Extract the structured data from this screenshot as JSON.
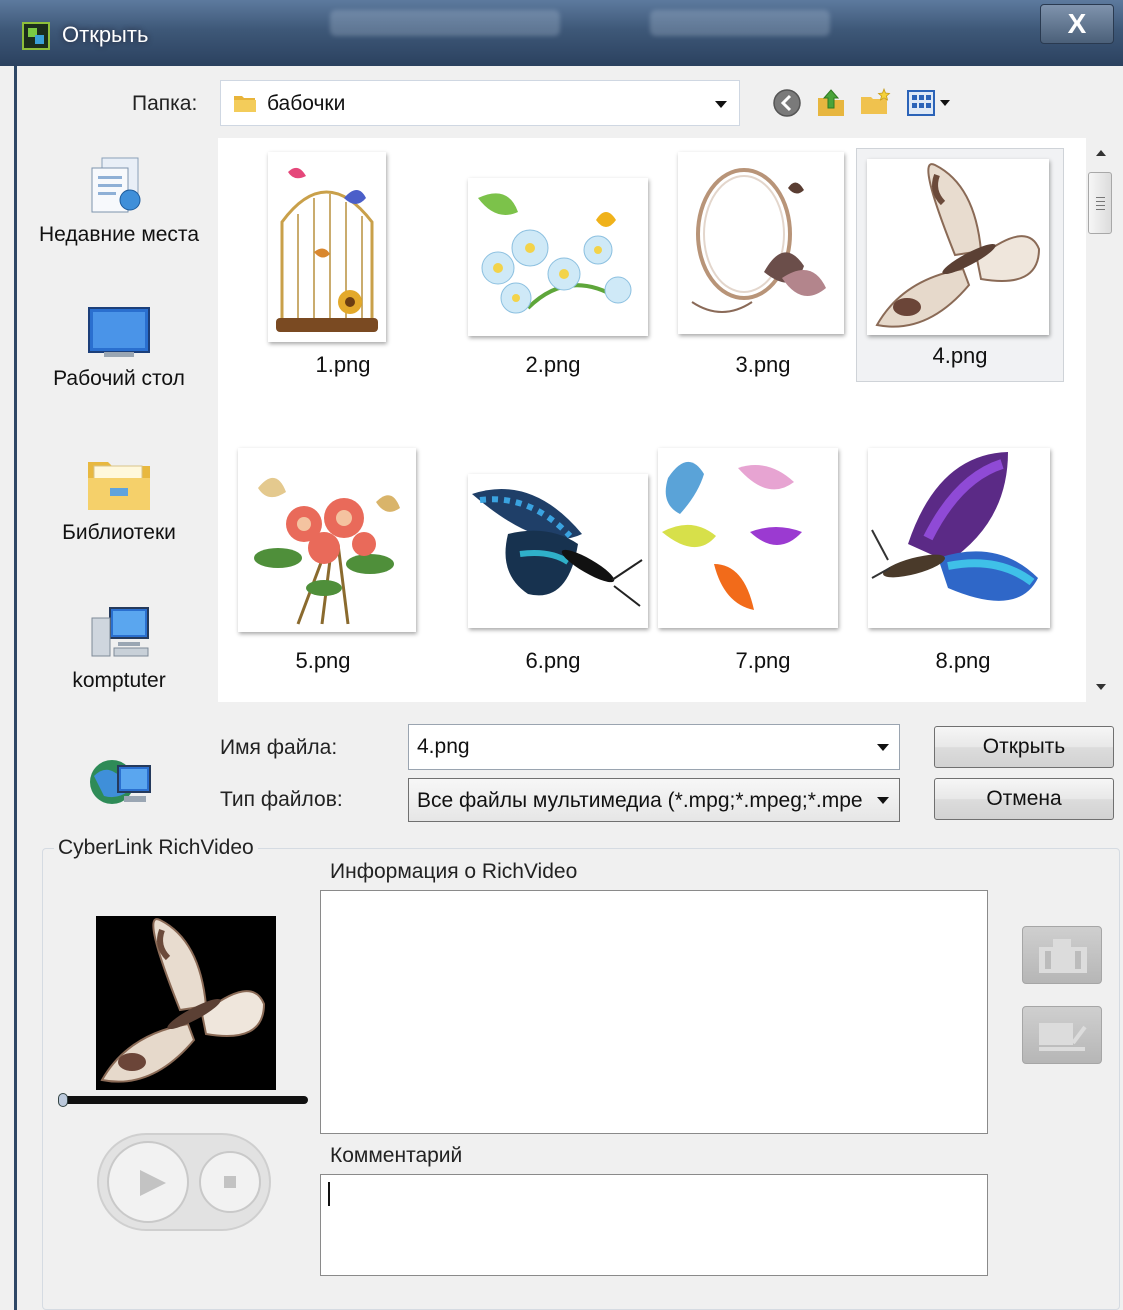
{
  "window": {
    "title": "Открыть",
    "close_label": "X"
  },
  "toolbar": {
    "folder_label": "Папка:",
    "folder_value": "бабочки"
  },
  "places": [
    {
      "label": "Недавние места",
      "icon": "recent-places-icon"
    },
    {
      "label": "Рабочий стол",
      "icon": "desktop-icon"
    },
    {
      "label": "Библиотеки",
      "icon": "libraries-icon"
    },
    {
      "label": "komptuter",
      "icon": "computer-icon"
    },
    {
      "label": "",
      "icon": "network-icon"
    }
  ],
  "files": [
    {
      "name": "1.png",
      "selected": false
    },
    {
      "name": "2.png",
      "selected": false
    },
    {
      "name": "3.png",
      "selected": false
    },
    {
      "name": "4.png",
      "selected": true
    },
    {
      "name": "5.png",
      "selected": false
    },
    {
      "name": "6.png",
      "selected": false
    },
    {
      "name": "7.png",
      "selected": false
    },
    {
      "name": "8.png",
      "selected": false
    }
  ],
  "form": {
    "filename_label": "Имя файла:",
    "filename_value": "4.png",
    "filetype_label": "Тип файлов:",
    "filetype_value": "Все файлы мультимедиа (*.mpg;*.mpeg;*.mpe",
    "open_button": "Открыть",
    "cancel_button": "Отмена"
  },
  "richvideo": {
    "group_title": "CyberLink RichVideo",
    "info_label": "Информация о RichVideo",
    "comment_label": "Комментарий",
    "info_text": "",
    "comment_text": ""
  },
  "colors": {
    "titlebar": "#3e5878",
    "selection": "#f1f2f4",
    "accent": "#2e4766"
  }
}
